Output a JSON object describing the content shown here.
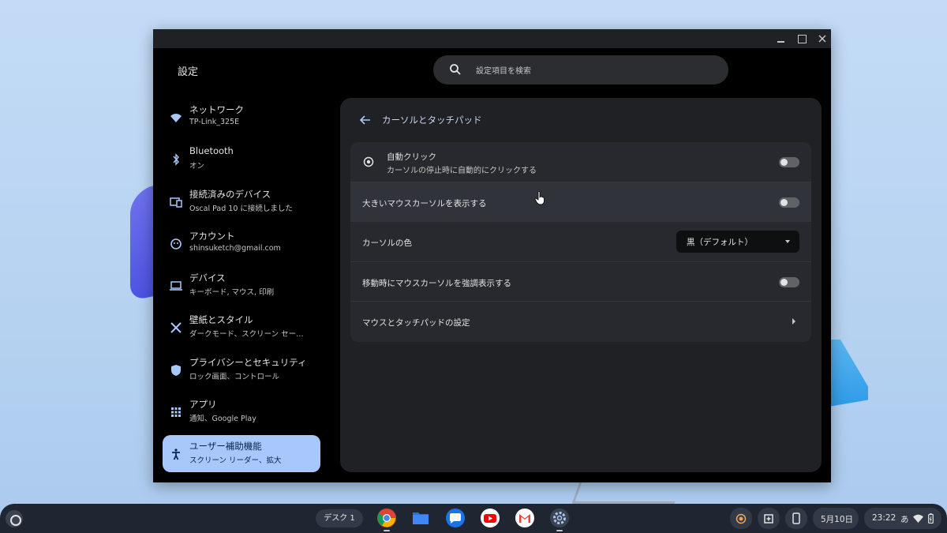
{
  "window": {
    "title": "設定"
  },
  "search": {
    "placeholder": "設定項目を検索"
  },
  "sidebar": {
    "items": [
      {
        "label": "ネットワーク",
        "sub": "TP-Link_325E",
        "icon": "wifi-icon"
      },
      {
        "label": "Bluetooth",
        "sub": "オン",
        "icon": "bluetooth-icon"
      },
      {
        "label": "接続済みのデバイス",
        "sub": "Oscal Pad 10 に接続しました",
        "icon": "connected-devices-icon"
      },
      {
        "label": "アカウント",
        "sub": "shinsuketch@gmail.com",
        "icon": "account-icon"
      },
      {
        "label": "デバイス",
        "sub": "キーボード, マウス, 印刷",
        "icon": "laptop-icon"
      },
      {
        "label": "壁紙とスタイル",
        "sub": "ダークモード、スクリーン セー…",
        "icon": "palette-icon"
      },
      {
        "label": "プライバシーとセキュリティ",
        "sub": "ロック画面、コントロール",
        "icon": "shield-icon"
      },
      {
        "label": "アプリ",
        "sub": "通知、Google Play",
        "icon": "apps-grid-icon"
      },
      {
        "label": "ユーザー補助機能",
        "sub": "スクリーン リーダー、拡大",
        "icon": "accessibility-icon",
        "active": true
      }
    ]
  },
  "main": {
    "heading": "カーソルとタッチパッド",
    "rows": {
      "autoclick": {
        "label": "自動クリック",
        "sub": "カーソルの停止時に自動的にクリックする",
        "on": false
      },
      "large_cursor": {
        "label": "大きいマウスカーソルを表示する",
        "on": false
      },
      "cursor_color": {
        "label": "カーソルの色",
        "value": "黒（デフォルト）"
      },
      "highlight_cursor": {
        "label": "移動時にマウスカーソルを強調表示する",
        "on": false
      },
      "mouse_touchpad": {
        "label": "マウスとタッチパッドの設定"
      }
    }
  },
  "shelf": {
    "desk": "デスク 1",
    "apps": [
      "chrome-icon",
      "files-icon",
      "messages-icon",
      "youtube-icon",
      "gmail-icon",
      "settings-icon"
    ],
    "date": "5月10日",
    "time": "23:22",
    "ime": "あ"
  },
  "colors": {
    "accent": "#a8c7fa",
    "window_bg": "#000000",
    "card_bg": "#1f2125",
    "shelf_bg": "#1f2632"
  }
}
